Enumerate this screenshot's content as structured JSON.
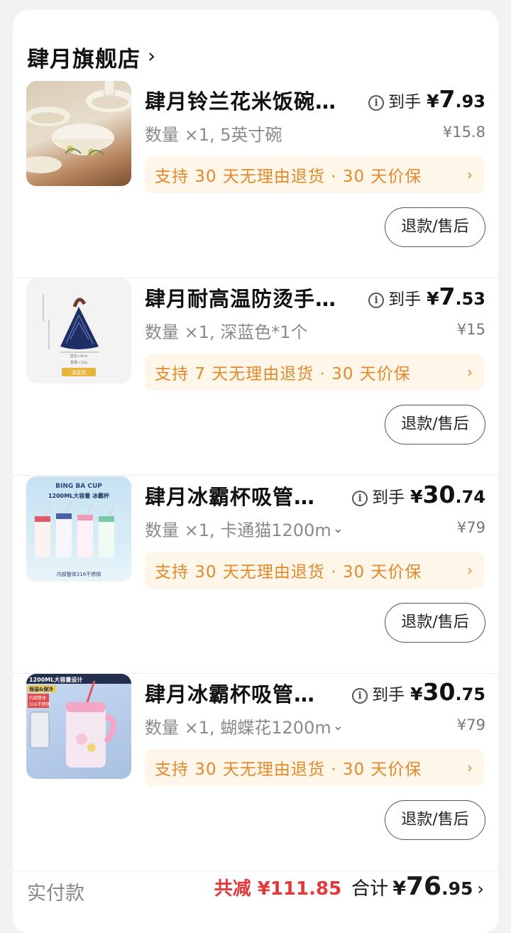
{
  "store": {
    "name": "肆月旗舰店",
    "chevron_icon": "chevron-right-icon"
  },
  "items": [
    {
      "title": "肆月铃兰花米饭碗…",
      "quantity": "数量 ×1, 5英寸碗",
      "price_label": "到手",
      "currency": "¥",
      "price_int": "7",
      "price_dec": ".93",
      "original_price": "¥15.8",
      "guarantee": "支持 30 天无理由退货 · 30 天价保",
      "refund_label": "退款/售后",
      "has_spec_dropdown": false
    },
    {
      "title": "肆月耐高温防烫手…",
      "quantity": "数量 ×1, 深蓝色*1个",
      "price_label": "到手",
      "currency": "¥",
      "price_int": "7",
      "price_dec": ".53",
      "original_price": "¥15",
      "guarantee": "支持 7 天无理由退货 · 30 天价保",
      "refund_label": "退款/售后",
      "has_spec_dropdown": false,
      "thumb_texts": {
        "tag": "深蓝色",
        "dim1": "直径≈9cm",
        "dim2": "重量≈12g"
      }
    },
    {
      "title": "肆月冰霸杯吸管…",
      "quantity": "数量 ×1, 卡通猫1200m",
      "price_label": "到手",
      "currency": "¥",
      "price_int": "30",
      "price_dec": ".74",
      "original_price": "¥79",
      "guarantee": "支持 30 天无理由退货 · 30 天价保",
      "refund_label": "退款/售后",
      "has_spec_dropdown": true,
      "thumb_texts": {
        "brand": "BING BA CUP",
        "line": "1200ML大容量 冰霸杯",
        "footer": "内部整体316不锈钢"
      }
    },
    {
      "title": "肆月冰霸杯吸管…",
      "quantity": "数量 ×1, 蝴蝶花1200m",
      "price_label": "到手",
      "currency": "¥",
      "price_int": "30",
      "price_dec": ".75",
      "original_price": "¥79",
      "guarantee": "支持 30 天无理由退货 · 30 天价保",
      "refund_label": "退款/售后",
      "has_spec_dropdown": true,
      "thumb_texts": {
        "line1": "1200ML大容量设计",
        "line2": "保温&保冷",
        "line3": "内部整体",
        "line4": "316不锈钢"
      }
    }
  ],
  "footer": {
    "label": "实付款",
    "discount": "共减 ¥111.85",
    "total_label": "合计",
    "currency": "¥",
    "total_int": "76",
    "total_dec": ".95"
  },
  "colors": {
    "accent_orange": "#e08a2c",
    "guarantee_bg": "#fff6ea",
    "discount_red": "#e4393c"
  }
}
